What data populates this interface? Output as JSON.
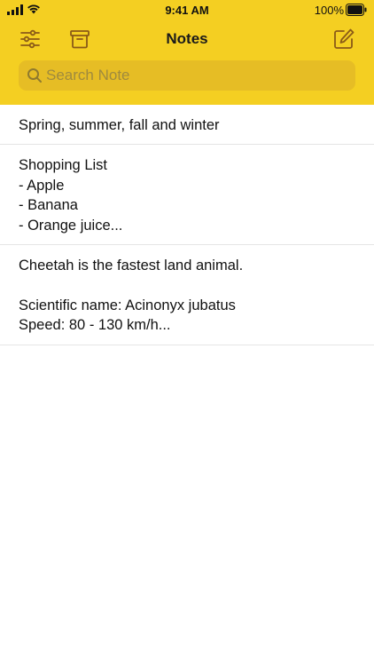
{
  "status_bar": {
    "time": "9:41 AM",
    "battery": "100%"
  },
  "nav": {
    "title": "Notes",
    "icons": {
      "left1": "sliders-icon",
      "left2": "archive-icon",
      "right": "compose-icon"
    }
  },
  "search": {
    "placeholder": "Search Note",
    "value": ""
  },
  "notes": [
    {
      "text": "Spring, summer, fall and winter"
    },
    {
      "text": "Shopping List\n- Apple\n- Banana\n- Orange juice..."
    },
    {
      "text": "Cheetah is the fastest land animal.\n\nScientific name: Acinonyx jubatus\nSpeed: 80 - 130 km/h..."
    }
  ],
  "colors": {
    "header_bg": "#f4cf22",
    "search_bg": "#e6bd25",
    "icon_color": "#8a5a18"
  }
}
